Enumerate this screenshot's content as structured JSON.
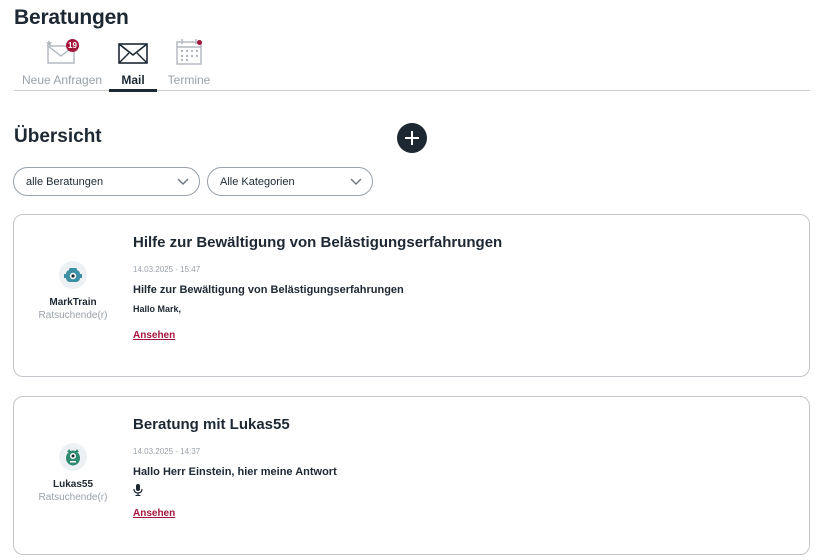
{
  "header": {
    "title": "Beratungen"
  },
  "tabs": [
    {
      "label": "Neue Anfragen",
      "icon": "envelope-star-icon",
      "badge": "19"
    },
    {
      "label": "Mail",
      "icon": "envelope-icon",
      "active": true
    },
    {
      "label": "Termine",
      "icon": "calendar-icon",
      "notification_dot": true
    }
  ],
  "section": {
    "title": "Übersicht",
    "add_icon": "plus-circle-icon"
  },
  "filters": {
    "beratungen": {
      "value": "alle Beratungen"
    },
    "kategorien": {
      "value": "Alle Kategorien"
    }
  },
  "cards": [
    {
      "title": "Hilfe zur Bewältigung von Belästigungserfahrungen",
      "date": "14.03.2025 - 15:47",
      "subject": "Hilfe zur Bewältigung von Belästigungserfahrungen",
      "preview": "Hallo Mark,",
      "link": "Ansehen",
      "user": {
        "name": "MarkTrain",
        "role": "Ratsuchende(r)",
        "avatar": "robot-avatar-icon"
      }
    },
    {
      "title": "Beratung mit Lukas55",
      "date": "14.03.2025 - 14:37",
      "subject": "Hallo Herr Einstein, hier meine Antwort",
      "preview_icon": "microphone-icon",
      "link": "Ansehen",
      "user": {
        "name": "Lukas55",
        "role": "Ratsuchende(r)",
        "avatar": "monster-avatar-icon"
      }
    }
  ],
  "colors": {
    "primary": "#1d2833",
    "accent": "#a4153b",
    "muted": "#9aa2aa",
    "border": "#c2c7cc",
    "avatar_teal": "#3d8fa3",
    "avatar_green": "#2d8a6f"
  }
}
